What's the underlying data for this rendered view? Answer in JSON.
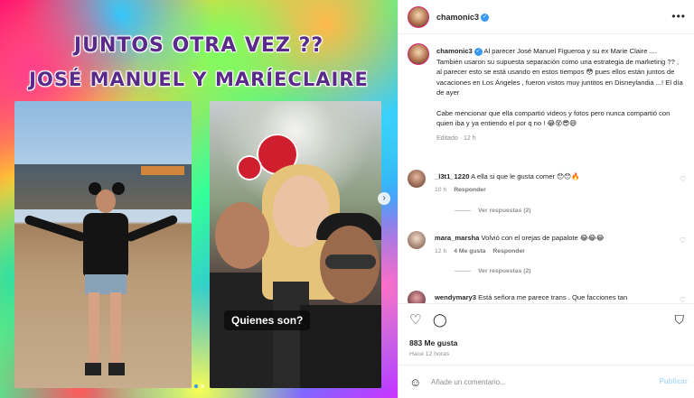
{
  "media": {
    "headline_line1": "JUNTOS OTRA VEZ ??",
    "headline_line2": "JOSÉ MANUEL Y MARÍECLAIRE",
    "photo2_caption": "Quienes son?",
    "carousel_next": "›",
    "carousel_total": 2,
    "carousel_active": 1
  },
  "header": {
    "username": "chamonic3",
    "verified_mark": "✓",
    "more_label": "•••"
  },
  "caption": {
    "username": "chamonic3",
    "text": "Al parecer José Manuel Figueroa y su ex Marie Claire .... También usaron su supuesta separación como una estrategia de marketing ?? , al parecer esto se está usando en estos tiempos 😳 pues ellos están juntos de vacaciones en Los Ángeles , fueron vistos muy juntitos en Disneylandia ...! El día de ayer",
    "text2": "Cabe mencionar que ella compartió videos y fotos pero nunca compartió con quien iba y ya entiendo el por q no ! 😂😵😎😅",
    "edited": "Editado",
    "time": "12 h"
  },
  "comments": [
    {
      "username": "_l3t1_1220",
      "text": "A ella si que le gusta comer 😯😯🔥",
      "time": "10 h",
      "likes": "",
      "reply": "Responder",
      "view_replies": "Ver respuestas (2)"
    },
    {
      "username": "mara_marsha",
      "text": "Volvió con el orejas de papalote 😂😂😂",
      "time": "12 h",
      "likes": "4 Me gusta",
      "reply": "Responder",
      "view_replies": "Ver respuestas (2)"
    },
    {
      "username": "wendymary3",
      "text": "Está señora me parece trans . Que facciones tan",
      "time": "",
      "likes": "",
      "reply": "",
      "view_replies": ""
    }
  ],
  "actions": {
    "like_icon": "♡",
    "comment_icon": "◯",
    "save_icon": "⛉",
    "likes": "883 Me gusta",
    "posted": "Hace 12 horas"
  },
  "composer": {
    "emoji_icon": "☺",
    "placeholder": "Añade un comentario...",
    "publish": "Publicar"
  },
  "colors": {
    "link_blue": "#3897f0",
    "publish_disabled": "#b3dbff",
    "story_ring": "#d62976"
  }
}
